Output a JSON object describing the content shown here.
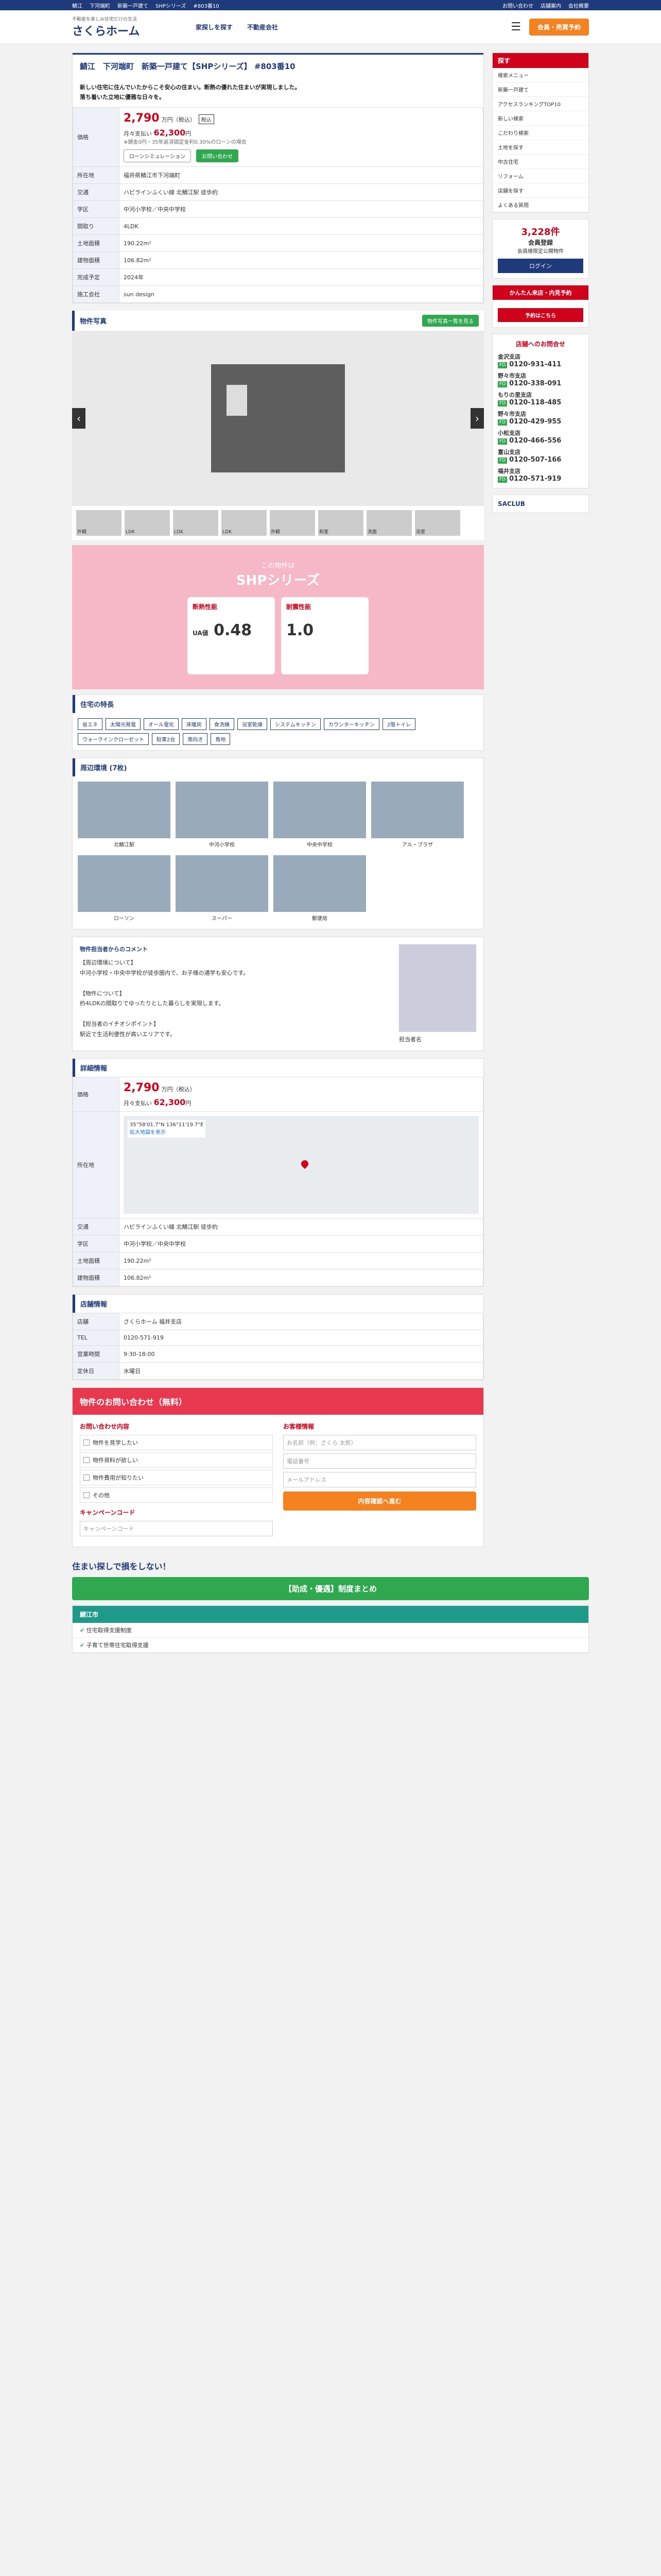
{
  "topbar": {
    "links": [
      "鯖江",
      "下河端町",
      "新築一戸建て",
      "SHPシリーズ",
      "#803番10"
    ],
    "right": [
      "お問い合わせ",
      "店舗案内",
      "会社概要"
    ]
  },
  "header": {
    "logo_sub": "不動産を楽しみ住宅だけの生活",
    "logo": "さくらホーム",
    "nav": [
      "家探しを探す",
      "不動産会社"
    ],
    "cta": "会員・売買予約"
  },
  "property": {
    "title": "鯖江　下河端町　新築一戸建て【SHPシリーズ】 #803番10",
    "desc": "新しい住宅に住んでいたからこそ安心の住まい。断熱の優れた住まいが実現しました。",
    "desc2": "落ち着いた立地に優雅な日々を。",
    "price": "2,790",
    "price_unit": "万円（税込）",
    "tax": "税込",
    "pay_label": "月々支払い",
    "pay": "62,300",
    "pay_unit": "円",
    "pay_note": "※頭金0円・35年返済固定金利0.30%のローンの場合",
    "sim_btn": "ローンシミュレーション",
    "contact_btn": "お問い合わせ",
    "address_label": "所在地",
    "address": "福井県鯖江市下河端町",
    "access_label": "交通",
    "access": "ハピラインふくい線 北鯖江駅 徒歩約",
    "school_label": "学区",
    "school": "中河小学校／中央中学校",
    "layout_label": "間取り",
    "layout": "4LDK",
    "land_label": "土地面積",
    "land": "190.22m²",
    "build_label": "建物面積",
    "build": "106.82m²",
    "complete_label": "完成予定",
    "complete": "2024年",
    "seller_label": "施工会社",
    "seller": "sun design"
  },
  "photo": {
    "label": "物件写真",
    "btn": "物件写真一覧を見る",
    "caption": "",
    "counter": ""
  },
  "thumbs": [
    "外観",
    "LDK",
    "LDK",
    "LDK",
    "外観",
    "和室",
    "洗面",
    "浴室",
    "LDK"
  ],
  "banner": {
    "title": "SHPシリーズ",
    "sub": "この物件は",
    "c1": "断熱性能",
    "c1v": "0.48",
    "c2": "耐震性能",
    "c2v": "1.0",
    "c3": "UA値"
  },
  "features": {
    "label": "住宅の特長",
    "tags": [
      "省エネ",
      "太陽光発電",
      "オール電化",
      "床暖房",
      "食洗機",
      "浴室乾燥",
      "システムキッチン",
      "カウンターキッチン",
      "2階トイレ",
      "ウォークインクローゼット",
      "駐車2台",
      "南向き",
      "角地"
    ]
  },
  "env": {
    "label": "周辺環境 (7枚)",
    "items": [
      "北鯖江駅",
      "中河小学校",
      "中央中学校",
      "アル・プラザ",
      "ローソン",
      "スーパー",
      "郵便局"
    ]
  },
  "comment": {
    "title": "物件担当者からのコメント",
    "p1": "【周辺環境について】",
    "p2": "中河小学校・中央中学校が徒歩圏内で、お子様の通学も安心です。",
    "p3": "【物件について】",
    "p4": "約4LDKの間取りでゆったりとした暮らしを実現します。",
    "p5": "【担当者のイチオシポイント】",
    "p6": "駅近で生活利便性が高いエリアです。",
    "staff": "担当者名"
  },
  "detail": {
    "label": "詳細情報",
    "coords": "35°58'01.7\"N 136°11'19.7\"E",
    "map_link": "拡大地図を表示"
  },
  "shop": {
    "label": "店舗情報",
    "name": "さくらホーム 福井支店",
    "tel": "0120-571-919",
    "hours": "9:30-18:00",
    "holiday": "水曜日"
  },
  "form": {
    "title": "物件のお問い合わせ（無料）",
    "left_h": "お問い合わせ内容",
    "checks": [
      "物件を見学したい",
      "物件資料が欲しい",
      "物件費用が知りたい",
      "その他"
    ],
    "right_h": "お客様情報",
    "inputs": [
      "お名前（例：さくら 太郎）",
      "電話番号",
      "メールアドレス"
    ],
    "send": "内容確認へ進む",
    "note_h": "キャンペーンコード",
    "note_ph": "キャンペーンコード"
  },
  "side": {
    "nav_h": "探す",
    "items": [
      "検索メニュー",
      "新築一戸建て",
      "アクセスランキングTOP10",
      "新しい検索",
      "こだわり検索",
      "土地を探す",
      "中古住宅",
      "リフォーム",
      "店舗を探す",
      "よくある質問"
    ],
    "member_h": "会員登録",
    "member_big": "3,228件",
    "member_sub": "会員様限定公開物件",
    "login": "ログイン",
    "reserve_h": "かんたん来店・内見予約",
    "reserve_b": "予約はこちら",
    "tel_h": "店舗へのお問合せ",
    "stores": [
      {
        "name": "金沢支店",
        "tel": "0120-931-411"
      },
      {
        "name": "野々市支店",
        "tel": "0120-338-091"
      },
      {
        "name": "もりの里支店",
        "tel": "0120-118-485"
      },
      {
        "name": "野々市支店",
        "tel": "0120-429-955"
      },
      {
        "name": "小松支店",
        "tel": "0120-466-556"
      },
      {
        "name": "富山支店",
        "tel": "0120-507-166"
      },
      {
        "name": "福井支店",
        "tel": "0120-571-919"
      }
    ],
    "saclub": "SACLUB"
  },
  "bottom": {
    "lead": "住まい探しで損をしない！",
    "btn": "【助成・優遇】制度まとめ",
    "area": "鯖江市",
    "rows": [
      "住宅取得支援制度",
      "子育て世帯住宅取得支援"
    ]
  }
}
